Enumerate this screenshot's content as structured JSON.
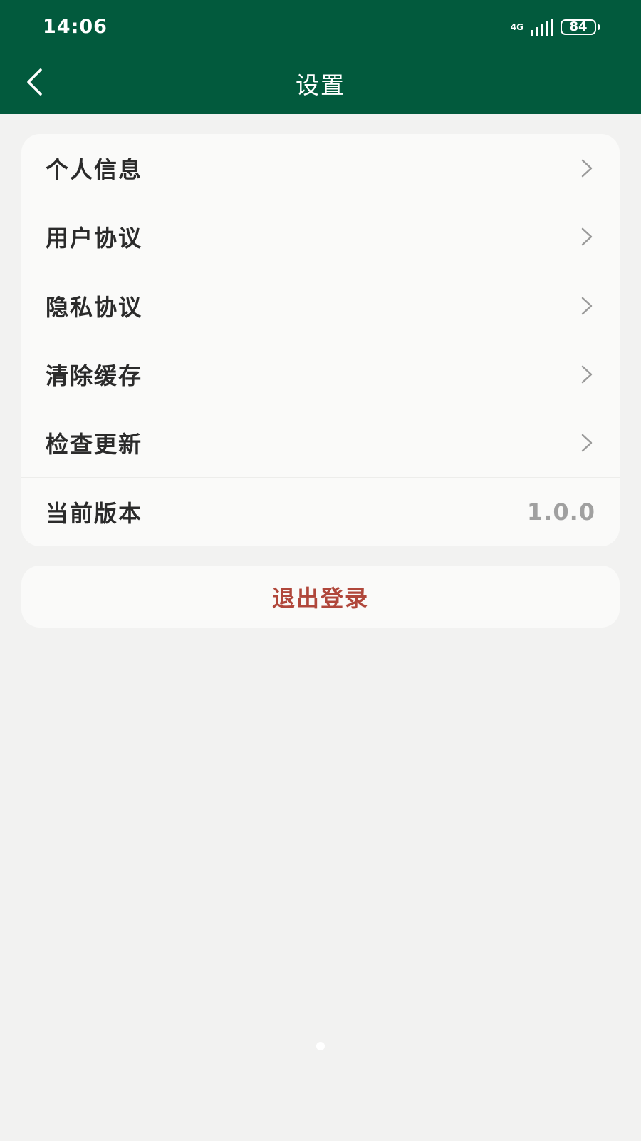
{
  "status_bar": {
    "time": "14:06",
    "network": "4G",
    "battery": "84"
  },
  "header": {
    "title": "设置"
  },
  "menu": {
    "items": [
      {
        "label": "个人信息"
      },
      {
        "label": "用户协议"
      },
      {
        "label": "隐私协议"
      },
      {
        "label": "清除缓存"
      },
      {
        "label": "检查更新"
      }
    ],
    "version": {
      "label": "当前版本",
      "value": "1.0.0"
    }
  },
  "logout": {
    "label": "退出登录"
  },
  "colors": {
    "header_bg": "#025a3d",
    "page_bg": "#f2f2f1",
    "card_bg": "#fafaf9",
    "logout_text": "#b0473b",
    "secondary_text": "#a0a0a0"
  }
}
